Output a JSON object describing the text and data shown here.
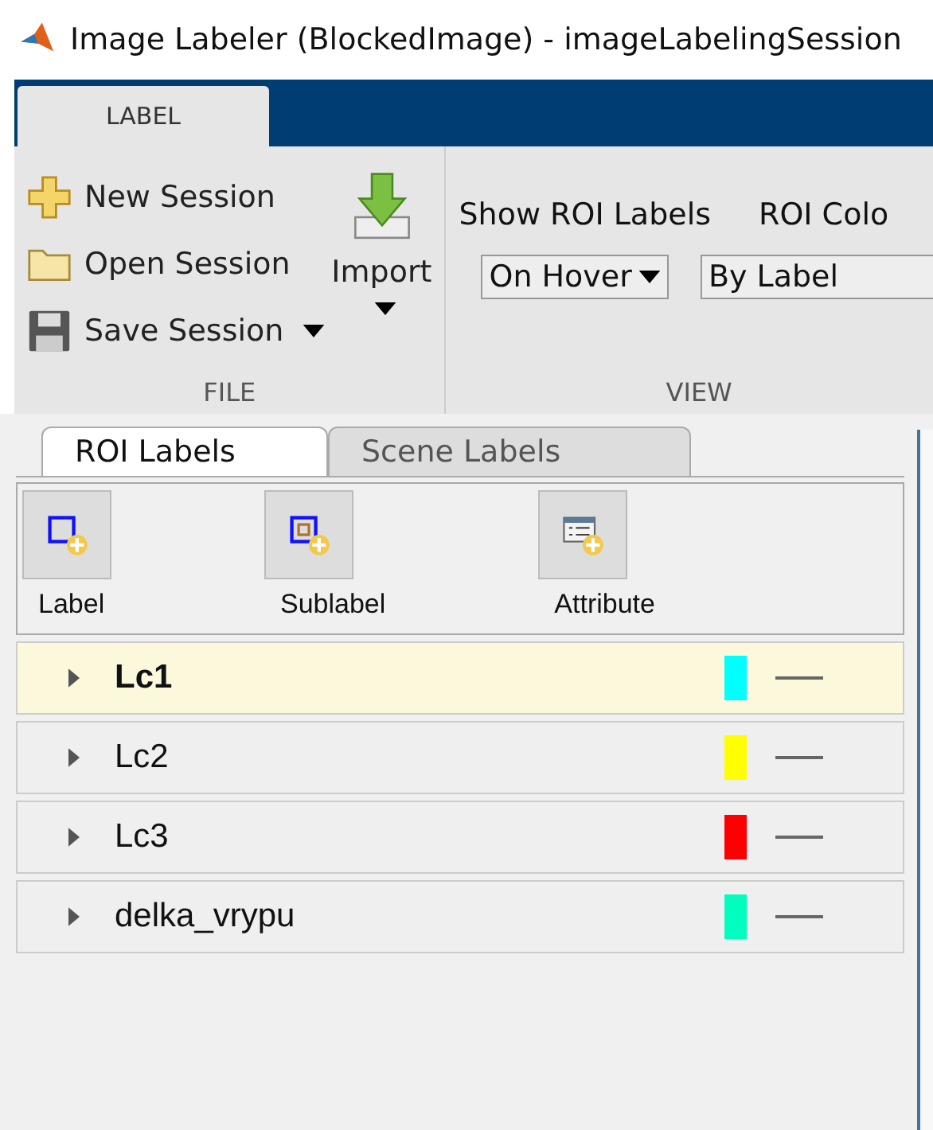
{
  "window": {
    "title": "Image Labeler (BlockedImage) - imageLabelingSession"
  },
  "ribbon_tabs": [
    {
      "label": "LABEL",
      "selected": true
    }
  ],
  "file_section": {
    "items": [
      {
        "label": "New Session",
        "kind": "new"
      },
      {
        "label": "Open Session",
        "kind": "open"
      },
      {
        "label": "Save Session",
        "kind": "save"
      }
    ],
    "import_label": "Import",
    "title": "FILE"
  },
  "view_section": {
    "show_roi_labels": "Show ROI Labels",
    "roi_color": "ROI Colo",
    "show_value": "On Hover",
    "color_value": "By Label",
    "title": "VIEW"
  },
  "panel_tabs": [
    {
      "label": "ROI Labels",
      "selected": true
    },
    {
      "label": "Scene Labels",
      "selected": false
    }
  ],
  "tools": [
    {
      "label": "Label",
      "kind": "label"
    },
    {
      "label": "Sublabel",
      "kind": "sublabel"
    },
    {
      "label": "Attribute",
      "kind": "attribute"
    }
  ],
  "labels": [
    {
      "name": "Lc1",
      "color": "#00ffff",
      "selected": true
    },
    {
      "name": "Lc2",
      "color": "#ffff00",
      "selected": false
    },
    {
      "name": "Lc3",
      "color": "#ff0000",
      "selected": false
    },
    {
      "name": "delka_vrypu",
      "color": "#00ffbf",
      "selected": false
    }
  ]
}
